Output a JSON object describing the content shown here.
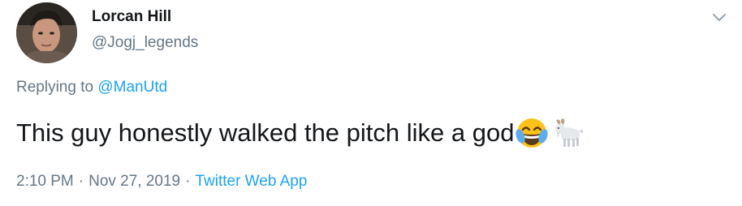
{
  "author": {
    "display_name": "Lorcan Hill",
    "handle": "@Jogj_legends"
  },
  "reply": {
    "prefix": "Replying to",
    "mention": "@ManUtd"
  },
  "tweet": {
    "text": "This guy honestly walked the pitch like a god",
    "emojis": [
      "face-with-tears-of-joy-icon",
      "goat-icon"
    ]
  },
  "meta": {
    "time": "2:10 PM",
    "date": "Nov 27, 2019",
    "separator": "·",
    "source": "Twitter Web App"
  },
  "colors": {
    "text": "#14171a",
    "muted": "#657786",
    "link": "#1da1f2",
    "background": "#ffffff"
  }
}
